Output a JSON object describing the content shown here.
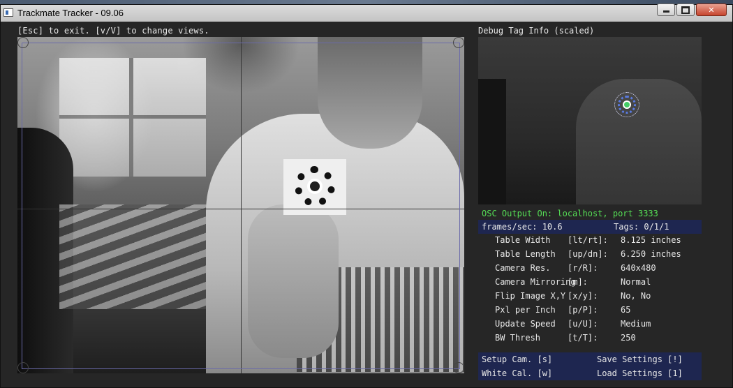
{
  "window": {
    "title": "Trackmate Tracker - 09.06",
    "buttons": [
      "minimize",
      "maximize",
      "close"
    ]
  },
  "hint": "[Esc] to exit.  [v/V] to change views.",
  "debug": {
    "title": "Debug Tag Info (scaled)"
  },
  "status": {
    "osc": "OSC Output On: localhost, port 3333",
    "fps": "frames/sec:  10.6",
    "tags": "Tags: 0/1/1"
  },
  "settings": [
    {
      "label": "Table Width",
      "key": "[lt/rt]:",
      "value": "8.125 inches"
    },
    {
      "label": "Table Length",
      "key": "[up/dn]:",
      "value": "6.250 inches"
    },
    {
      "label": "Camera Res.",
      "key": "[r/R]:",
      "value": "640x480"
    },
    {
      "label": "Camera Mirroring",
      "key": "[m]:",
      "value": "Normal"
    },
    {
      "label": "Flip Image X,Y",
      "key": "[x/y]:",
      "value": "No, No"
    },
    {
      "label": "Pxl per Inch",
      "key": "[p/P]:",
      "value": "65"
    },
    {
      "label": "Update Speed",
      "key": "[u/U]:",
      "value": "Medium"
    },
    {
      "label": "BW Thresh",
      "key": "[t/T]:",
      "value": "250"
    }
  ],
  "actions": {
    "setup_cam": "Setup Cam. [s]",
    "save_settings": "Save Settings [!]",
    "white_cal": "White Cal. [w]",
    "load_settings": "Load Settings [1]"
  },
  "colors": {
    "osc_text": "#55dd55",
    "panel_bg": "#1e2650",
    "calibration_rect": "#6a6aaa"
  }
}
